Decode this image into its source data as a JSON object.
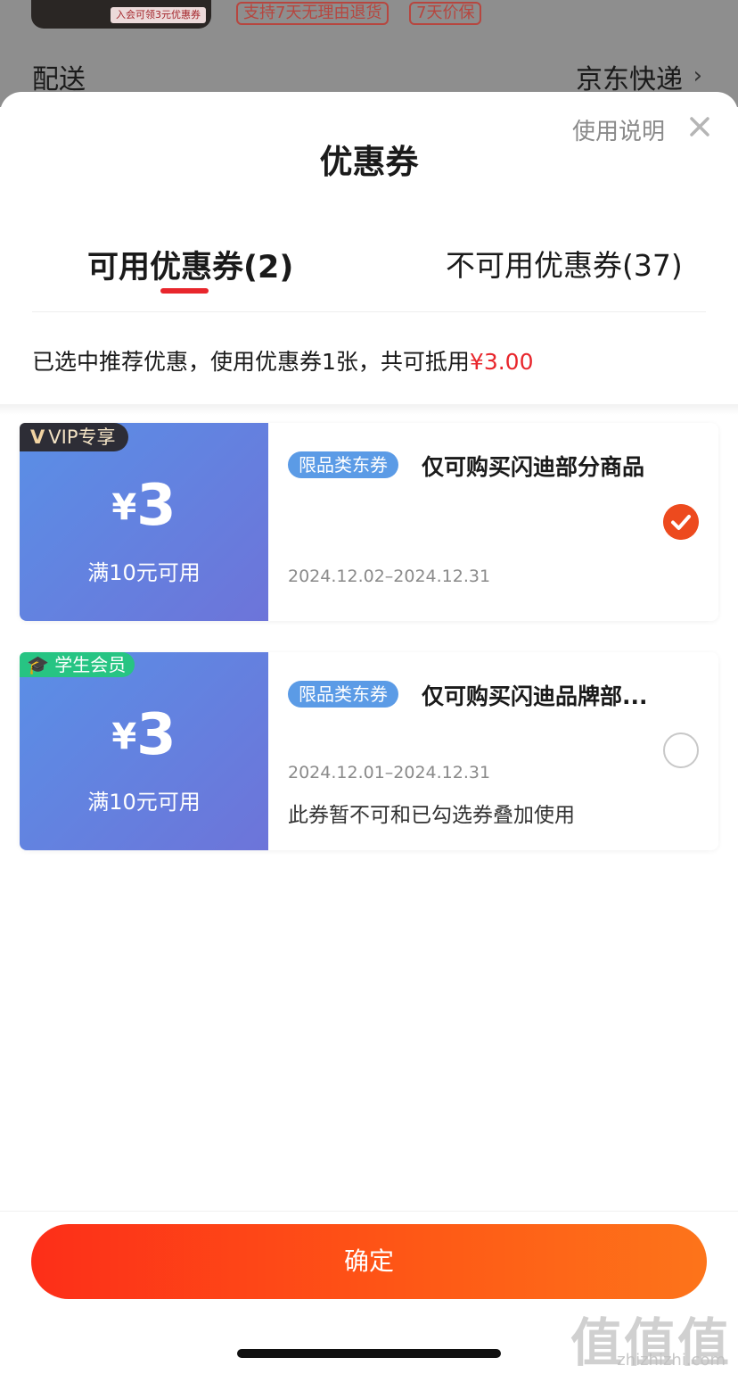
{
  "background": {
    "thumb_tag": "入会可领3元优惠券",
    "badges": [
      "支持7天无理由退货",
      "7天价保"
    ],
    "shipping_label": "配送",
    "shipping_value": "京东快递"
  },
  "sheet": {
    "title": "优惠券",
    "help_link": "使用说明"
  },
  "tabs": [
    {
      "label": "可用优惠券(2)",
      "active": true
    },
    {
      "label": "不可用优惠券(37)",
      "active": false
    }
  ],
  "summary": {
    "text": "已选中推荐优惠，使用优惠券1张，共可抵用",
    "amount": "¥3.00"
  },
  "coupons": [
    {
      "badge": "VIP专享",
      "badge_mark": "V",
      "currency": "¥",
      "amount": "3",
      "condition": "满10元可用",
      "tag": "限品类东券",
      "description": "仅可购买闪迪部分商品",
      "date_range": "2024.12.02–2024.12.31",
      "note": "",
      "selected": true
    },
    {
      "badge": "学生会员",
      "currency": "¥",
      "amount": "3",
      "condition": "满10元可用",
      "tag": "限品类东券",
      "description": "仅可购买闪迪品牌部...",
      "date_range": "2024.12.01–2024.12.31",
      "note": "此券暂不可和已勾选券叠加使用",
      "selected": false
    }
  ],
  "footer": {
    "confirm_label": "确定"
  },
  "watermark": {
    "logo": "值值值",
    "url": "zhizhizhi.com"
  },
  "colors": {
    "accent_red": "#e8262c",
    "coupon_blue": "#5a8fe6",
    "vip_badge": "#2d2d36",
    "student_badge": "#27c483",
    "check_orange": "#ed4a1e"
  }
}
